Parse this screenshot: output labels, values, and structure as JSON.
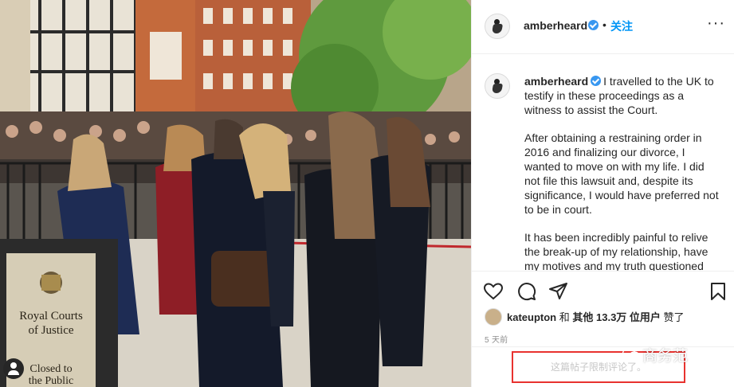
{
  "post": {
    "username": "amberheard",
    "follow_label": "关注",
    "dot": "•",
    "more_label": "···"
  },
  "photo": {
    "sign_title": "Royal Courts\nof Justice",
    "sign_subtitle": "Closed to\nthe Public",
    "photo_user_icon": "user-icon"
  },
  "caption": {
    "username": "amberheard",
    "paragraphs": [
      "I travelled to the UK to testify in these proceedings as a witness to assist the Court.",
      "After obtaining a restraining order in 2016 and finalizing our divorce, I wanted to move on with my life. I did not file this lawsuit and, despite its significance, I would have preferred not to be in court.",
      "It has been incredibly painful to relive the break-up of my relationship, have my motives and my truth questioned"
    ]
  },
  "actions": {
    "icons": [
      "heart-icon",
      "comment-icon",
      "share-icon",
      "bookmark-icon"
    ],
    "liked_by_user": "kateupton",
    "liked_by_joiner": "和",
    "liked_by_others": "其他 13.3万 位用户",
    "liked_by_suffix": "赞了",
    "timestamp": "5 天前"
  },
  "comments": {
    "restricted_text": "这篇帖子限制评论了。",
    "highlight_color": "#e8322f"
  },
  "watermark": {
    "text": "商务范"
  },
  "colors": {
    "accent": "#0095f6",
    "verified": "#3897f0",
    "muted": "#8e8e8e"
  }
}
